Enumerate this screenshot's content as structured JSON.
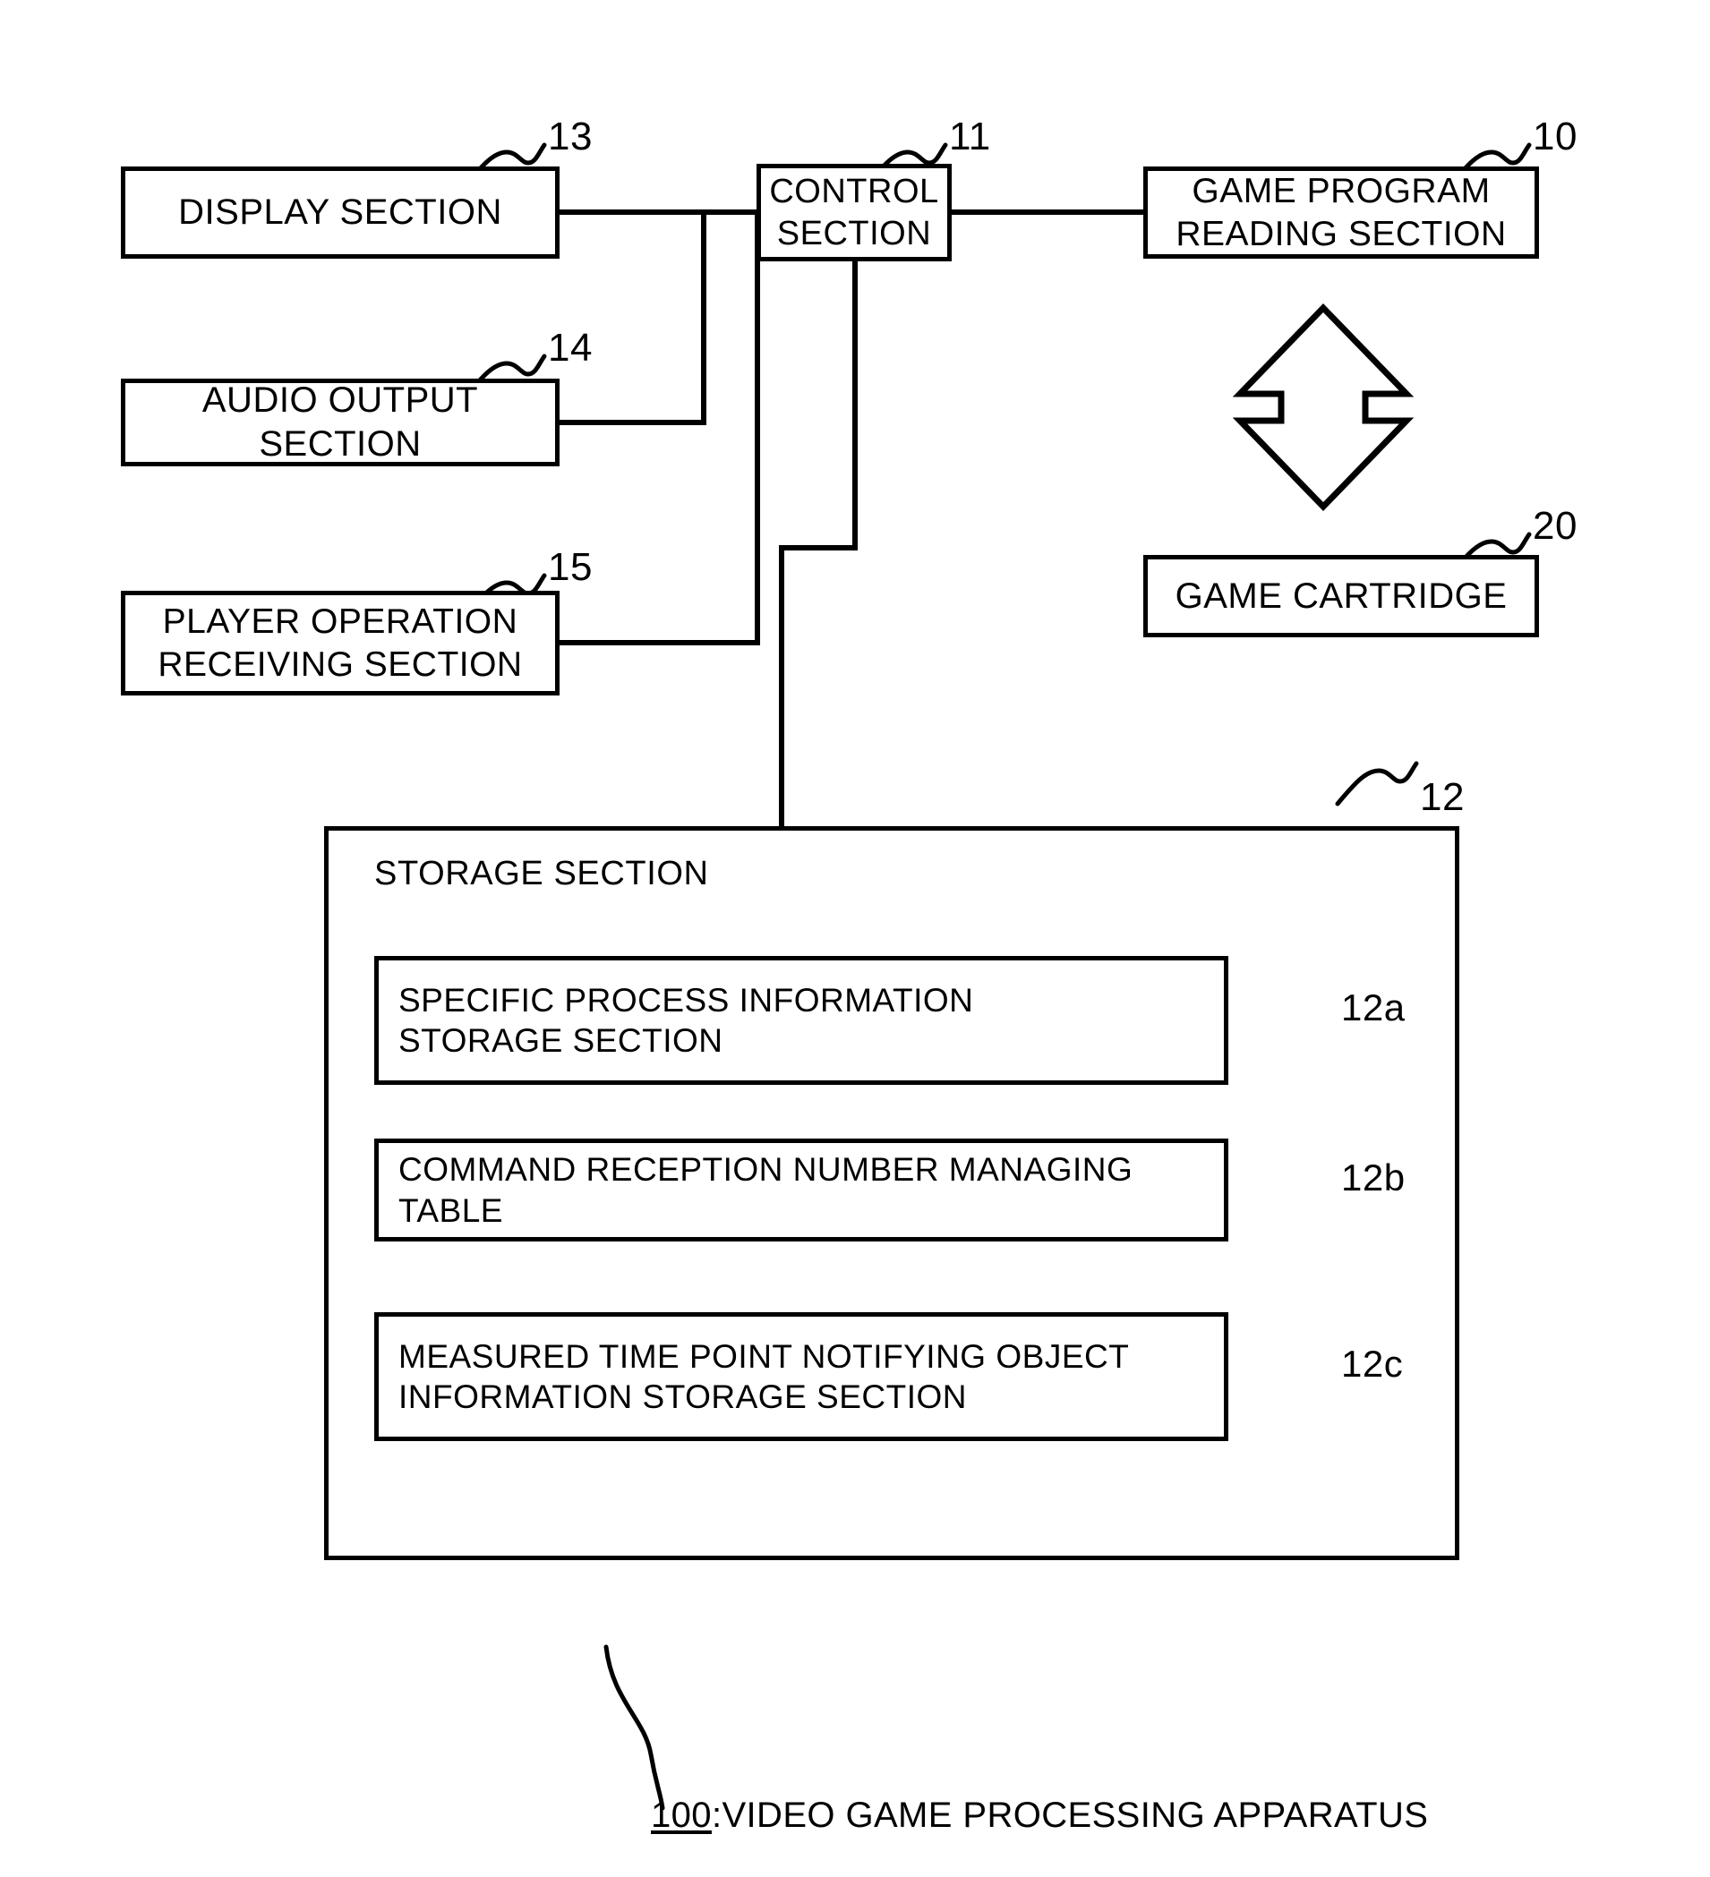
{
  "figure": {
    "caption_number": "100",
    "caption_separator": ":",
    "caption_label": "VIDEO GAME PROCESSING APPARATUS"
  },
  "blocks": {
    "display_section": {
      "label": "DISPLAY SECTION",
      "ref": "13"
    },
    "control_section": {
      "label": "CONTROL\nSECTION",
      "ref": "11"
    },
    "game_program_reading_section": {
      "label": "GAME PROGRAM\nREADING SECTION",
      "ref": "10"
    },
    "audio_output_section": {
      "label": "AUDIO OUTPUT SECTION",
      "ref": "14"
    },
    "player_operation_receiving_section": {
      "label": "PLAYER OPERATION\nRECEIVING SECTION",
      "ref": "15"
    },
    "game_cartridge": {
      "label": "GAME CARTRIDGE",
      "ref": "20"
    },
    "storage_section": {
      "label": "STORAGE SECTION",
      "ref": "12"
    }
  },
  "storage_items": [
    {
      "label": "SPECIFIC PROCESS INFORMATION\nSTORAGE SECTION",
      "ref": "12a"
    },
    {
      "label": "COMMAND RECEPTION NUMBER MANAGING TABLE",
      "ref": "12b"
    },
    {
      "label": "MEASURED TIME POINT NOTIFYING OBJECT\nINFORMATION STORAGE SECTION",
      "ref": "12c"
    }
  ],
  "icons": {
    "bidirectional_arrow": "double-headed-vertical-arrow"
  },
  "colors": {
    "stroke": "#000000",
    "background": "#ffffff"
  }
}
